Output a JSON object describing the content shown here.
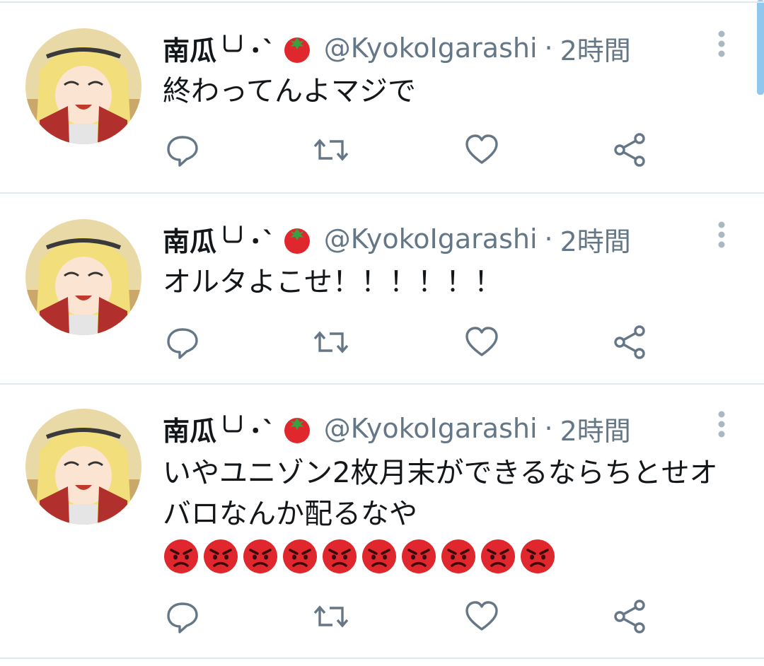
{
  "colors": {
    "text_primary": "#14171a",
    "text_secondary": "#657786",
    "icon_gray": "#657786",
    "divider": "#e1e8ed",
    "scrollbar": "#8fc7ef",
    "tomato": "#e0272e",
    "angry_face": "#e0272e"
  },
  "tweets": [
    {
      "display_name": "南瓜╰╯･`",
      "handle": "@KyokoIgarashi",
      "separator": "·",
      "time": "2時間",
      "text": "終わってんよマジで",
      "icons": [
        "reply-icon",
        "retweet-icon",
        "like-icon",
        "share-icon"
      ]
    },
    {
      "display_name": "南瓜╰╯･`",
      "handle": "@KyokoIgarashi",
      "separator": "·",
      "time": "2時間",
      "text": "オルタよこせ！！！！！！",
      "icons": [
        "reply-icon",
        "retweet-icon",
        "like-icon",
        "share-icon"
      ]
    },
    {
      "display_name": "南瓜╰╯･`",
      "handle": "@KyokoIgarashi",
      "separator": "·",
      "time": "2時間",
      "text": "いやユニゾン2枚月末ができるならちとせオバロなんか配るなや",
      "trailing_emoji": "angry-face-icon",
      "trailing_emoji_count": 10,
      "icons": [
        "reply-icon",
        "retweet-icon",
        "like-icon",
        "share-icon"
      ]
    }
  ]
}
